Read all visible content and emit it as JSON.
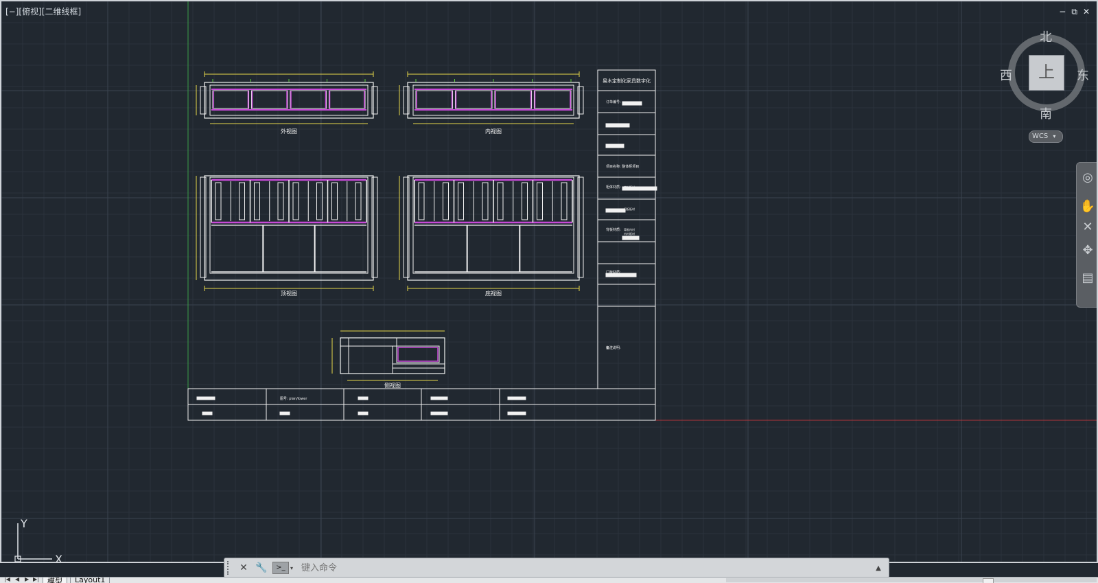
{
  "viewport": {
    "label": "[−][俯视][二维线框]",
    "controls": {
      "minimize": "−",
      "restore": "⧉",
      "close": "✕"
    }
  },
  "viewcube": {
    "north": "北",
    "south": "南",
    "east": "东",
    "west": "西",
    "face": "上",
    "wcs_label": "WCS"
  },
  "navbar": {
    "items": [
      "steering-wheel-icon",
      "pan-hand-icon",
      "zoom-icon",
      "orbit-icon",
      "showmotion-icon"
    ]
  },
  "drawing": {
    "views": {
      "outer_view": "外视图",
      "inner_view": "内视图",
      "top_view": "顶视图",
      "bottom_view": "底视图",
      "side_view": "侧视图"
    },
    "title_block": {
      "header": "易木定制化家具数字化",
      "rows": [
        "订单编号:",
        "",
        "",
        "项目名称: 整体柜项目",
        "柜体材质:",
        "",
        "背板材质:",
        "",
        "门板材质:",
        "",
        "备注说明:",
        "",
        "备注:"
      ],
      "row_subs": [
        "",
        "",
        "",
        "",
        "内衬板材",
        "门板板材",
        "背板内衬\n内衬板材",
        "",
        "",
        "",
        "",
        "",
        ""
      ]
    },
    "footer_table": {
      "cells": [
        "",
        "图号: plan/lower",
        "",
        "",
        "",
        "",
        "",
        "",
        "",
        ""
      ]
    }
  },
  "ucs": {
    "x_label": "X",
    "y_label": "Y"
  },
  "command_line": {
    "placeholder": "键入命令",
    "prompt_label": ">_"
  },
  "tabs": {
    "model": "模型",
    "layout1": "Layout1"
  },
  "colors": {
    "background": "#212830",
    "grid_major": "#3a4450",
    "grid_minor": "#2a323c",
    "line_white": "#f2f2f2",
    "dim_yellow": "#e8d84a",
    "dim_green": "#5ccf3a",
    "accent_magenta": "#c84ad8",
    "axis_red": "#b0353a",
    "axis_green": "#3aa048"
  }
}
